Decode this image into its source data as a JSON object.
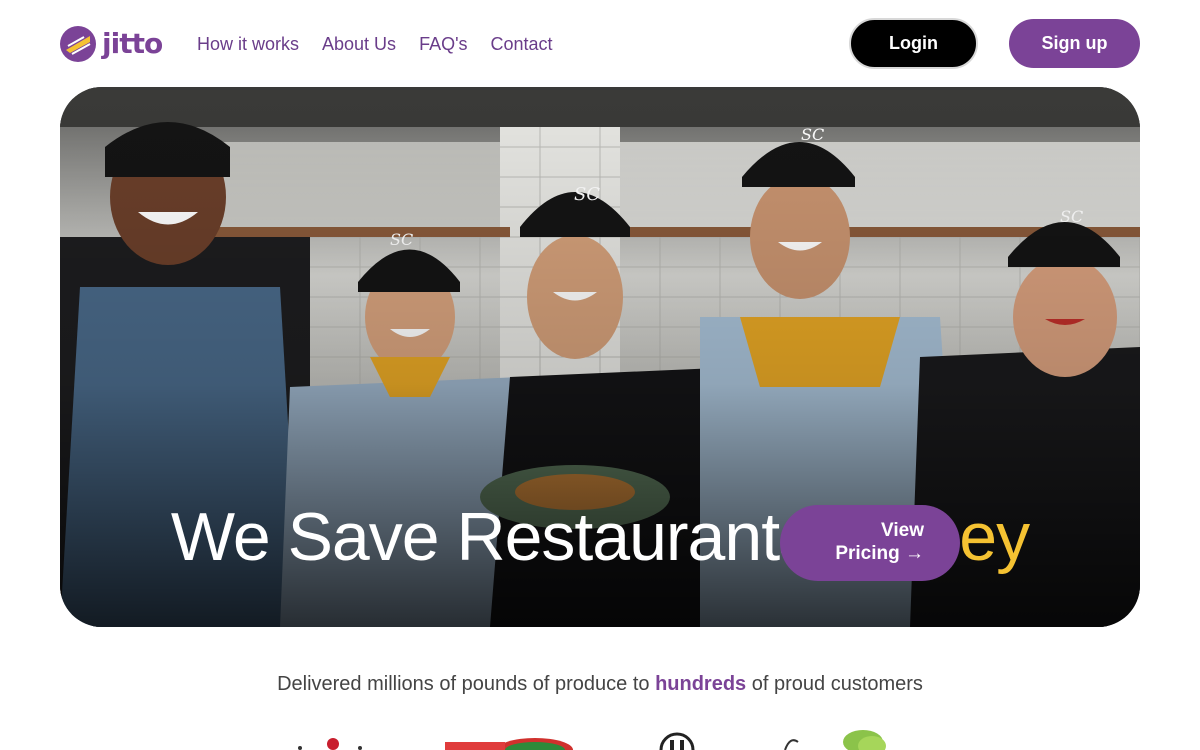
{
  "brand": {
    "name": "jitto",
    "primary_color": "#7b4397",
    "accent_color": "#f5c232"
  },
  "nav": {
    "items": [
      {
        "label": "How it works"
      },
      {
        "label": "About Us"
      },
      {
        "label": "FAQ's"
      },
      {
        "label": "Contact"
      }
    ]
  },
  "auth": {
    "login_label": "Login",
    "signup_label": "Sign up"
  },
  "hero": {
    "title_main": "We Save Restaurants ",
    "title_accent": "Money",
    "cta_line1": "View",
    "cta_line2": "Pricing →",
    "cap_lettering": "SC"
  },
  "tagline": {
    "pre": "Delivered millions of pounds of produce to ",
    "highlight": "hundreds",
    "post": " of proud customers"
  }
}
